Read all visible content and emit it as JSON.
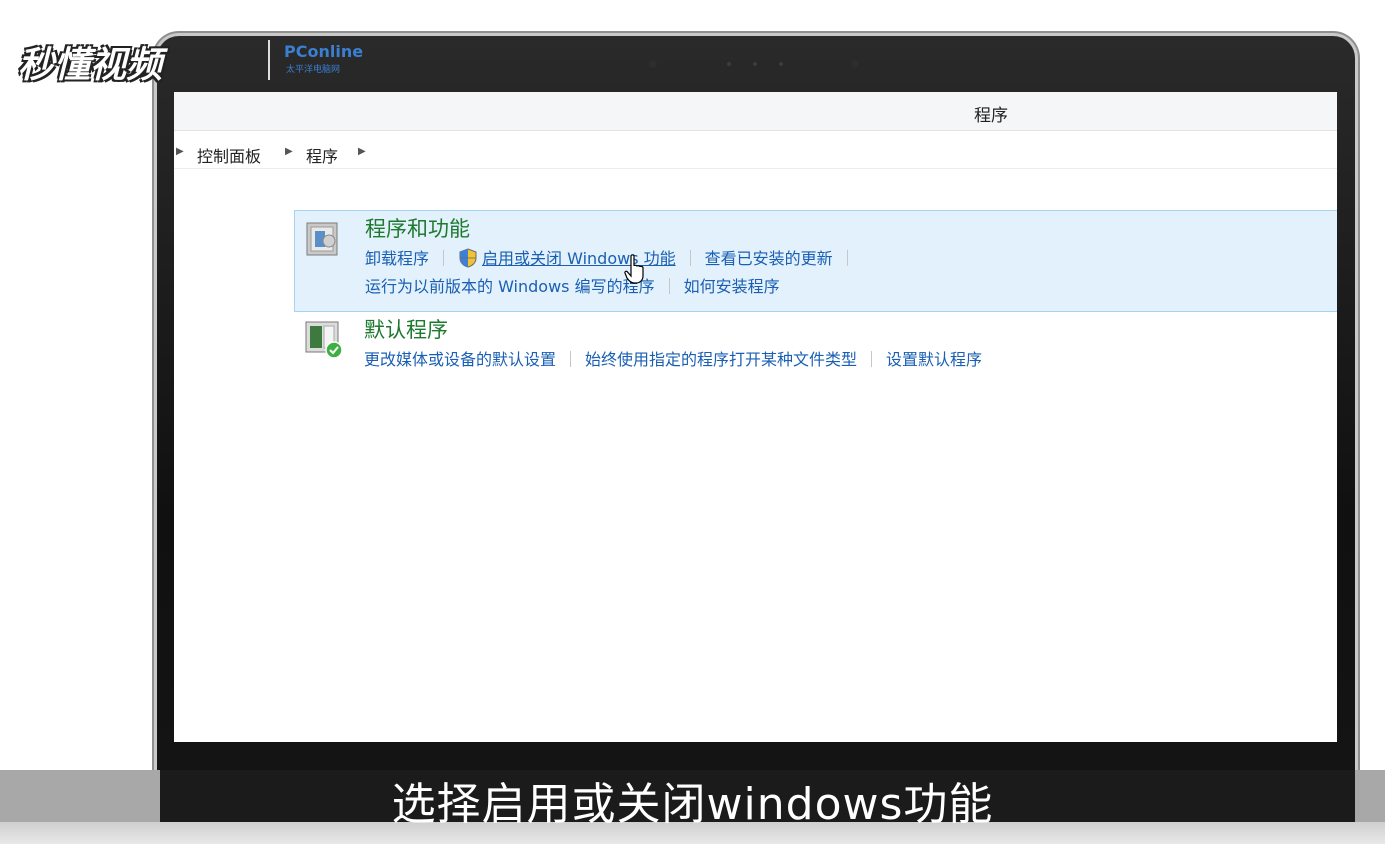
{
  "watermark": {
    "brand": "秒懂视频",
    "logo": "PConline",
    "logo_sub": "太平洋电脑网"
  },
  "window": {
    "title": "程序"
  },
  "breadcrumb": {
    "items": [
      "控制面板",
      "程序"
    ]
  },
  "categories": [
    {
      "title": "程序和功能",
      "row1": [
        "卸载程序",
        "启用或关闭 Windows 功能",
        "查看已安装的更新"
      ],
      "row2": [
        "运行为以前版本的 Windows 编写的程序",
        "如何安装程序"
      ]
    },
    {
      "title": "默认程序",
      "row1": [
        "更改媒体或设备的默认设置",
        "始终使用指定的程序打开某种文件类型",
        "设置默认程序"
      ]
    }
  ],
  "subtitle": "选择启用或关闭windows功能",
  "colors": {
    "category_title": "#1e7a2e",
    "link": "#1a5fb4",
    "highlight_bg": "#e2f1fb"
  }
}
